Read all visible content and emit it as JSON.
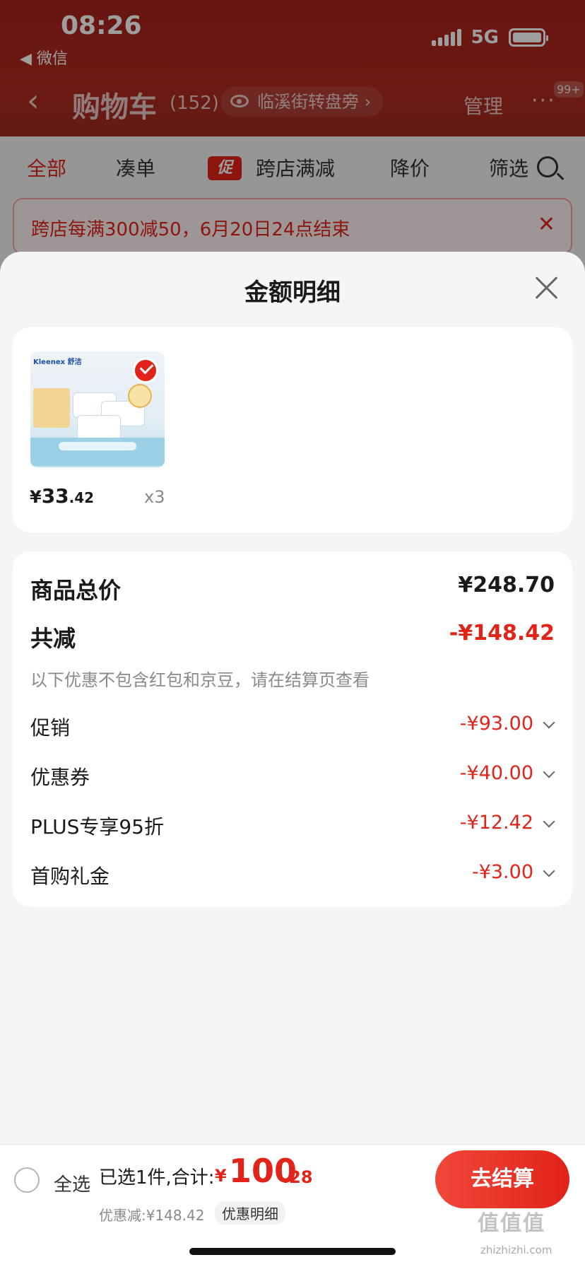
{
  "status_bar": {
    "time": "08:26",
    "back_app": "◀ 微信",
    "network": "5G"
  },
  "nav": {
    "back_icon": "‹",
    "title": "购物车",
    "count": "(152)",
    "address": "临溪街转盘旁 ›",
    "manage": "管理",
    "more": "···",
    "badge": "99+"
  },
  "filter_tabs": {
    "all": "全部",
    "bundle": "凑单",
    "promo_badge": "促",
    "cross_store": "跨店满减",
    "price_drop": "降价",
    "filter": "筛选"
  },
  "promo_banner": {
    "text": "跨店每满300减50，6月20日24点结束",
    "close": "✕"
  },
  "sheet": {
    "title": "金额明细",
    "product": {
      "image_brand": "Kleenex 舒洁",
      "price_symbol": "¥",
      "price_int": "33",
      "price_dec": ".42",
      "qty": "x3"
    },
    "summary": {
      "total_label": "商品总价",
      "total_value": "¥248.70",
      "reduce_label": "共减",
      "reduce_value": "-¥148.42",
      "reduce_note": "以下优惠不包含红包和京豆，请在结算页查看"
    },
    "discounts": [
      {
        "label": "促销",
        "value": "-¥93.00"
      },
      {
        "label": "优惠券",
        "value": "-¥40.00"
      },
      {
        "label": "PLUS专享95折",
        "value": "-¥12.42"
      },
      {
        "label": "首购礼金",
        "value": "-¥3.00"
      }
    ]
  },
  "bottom_bar": {
    "select_all": "全选",
    "selected_text": "已选1件,合计:",
    "total_symbol": "¥",
    "total_int": "100",
    "total_dec": ".28",
    "discount_note": "优惠减:¥148.42",
    "detail_link": "优惠明细",
    "checkout": "去结算"
  },
  "watermark": {
    "text": "值值值",
    "url": "zhizhizhi.com"
  },
  "colors": {
    "accent": "#e2231a",
    "header_red": "#a8231c"
  }
}
